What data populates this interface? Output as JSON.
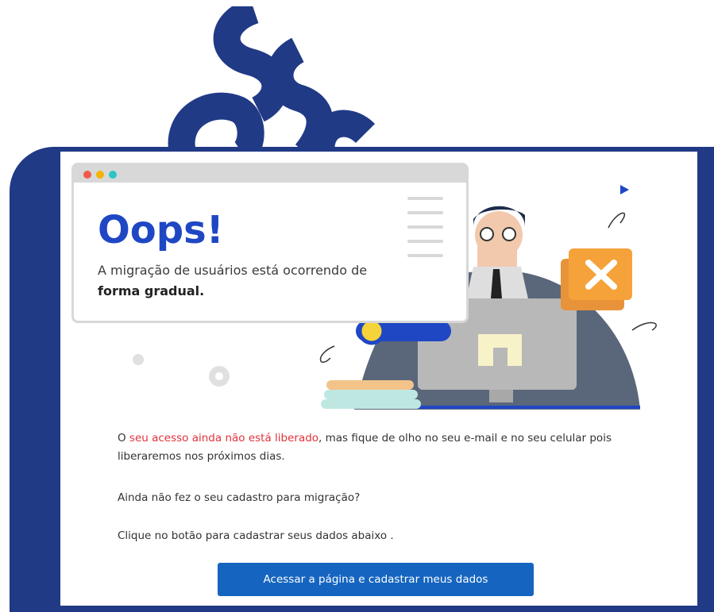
{
  "logo": {
    "icon": "institution-logo-icon",
    "color": "#213a86"
  },
  "browser": {
    "window_dots": [
      "#f05a4a",
      "#f4b400",
      "#2ec4c4"
    ],
    "title": "Oops!",
    "subtitle_prefix": "A migração de usuários está ocorrendo de ",
    "subtitle_bold": "forma gradual."
  },
  "message": {
    "para1_start": "O ",
    "para1_highlight": "seu acesso ainda não está liberado",
    "para1_end": ", mas fique de olho no seu e-mail e no seu celular pois liberaremos nos próximos dias.",
    "para2": "Ainda não fez o seu cadastro para migração?",
    "para3": "Clique no botão para cadastrar seus dados abaixo ."
  },
  "action": {
    "button_label": "Acessar a página e cadastrar meus dados"
  },
  "colors": {
    "frame": "#213a86",
    "accent": "#1f47c4",
    "highlight": "#e2323a",
    "button": "#1565c0"
  }
}
